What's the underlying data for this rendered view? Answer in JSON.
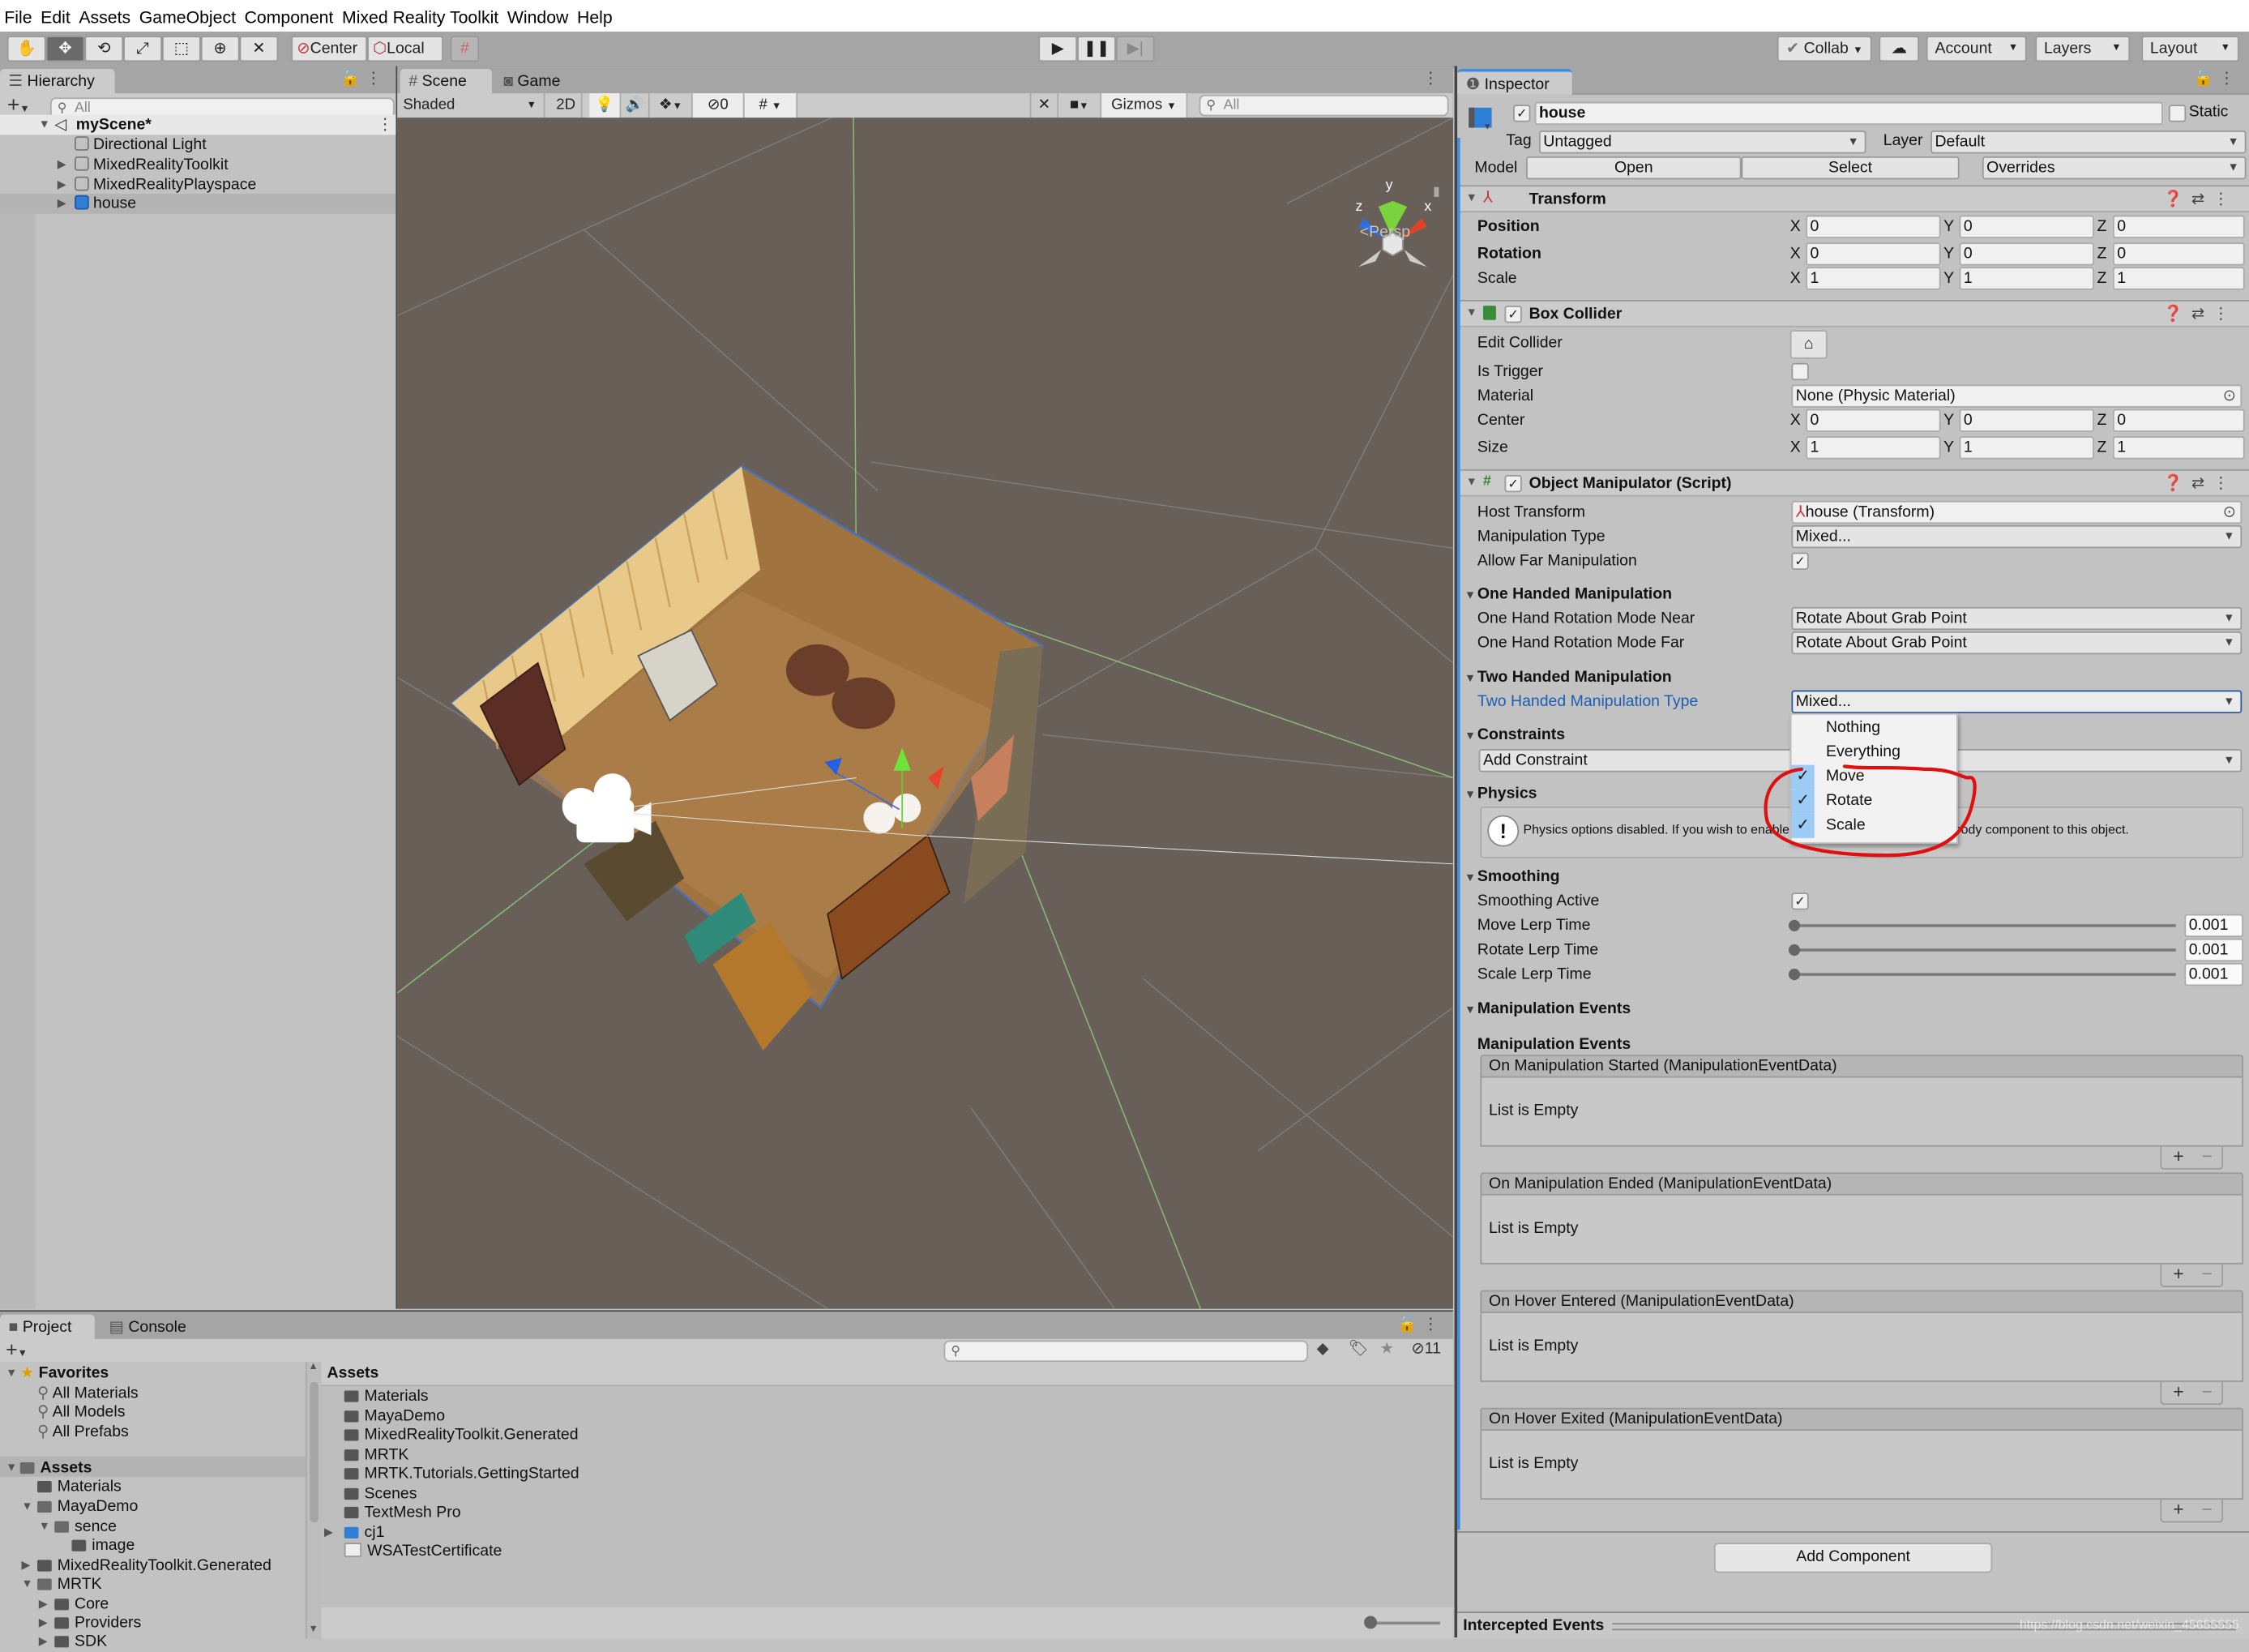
{
  "menu": [
    "File",
    "Edit",
    "Assets",
    "GameObject",
    "Component",
    "Mixed Reality Toolkit",
    "Window",
    "Help"
  ],
  "toolbar": {
    "tools": [
      "hand-tool",
      "move-tool",
      "rotate-tool",
      "scale-tool",
      "rect-tool",
      "transform-tool",
      "custom-tool"
    ],
    "pivot_label": "Center",
    "space_label": "Local",
    "collab_label": "Collab",
    "account_label": "Account",
    "layers_label": "Layers",
    "layout_label": "Layout"
  },
  "hierarchy": {
    "tab_label": "Hierarchy",
    "search_placeholder": "All",
    "scene_name": "myScene*",
    "items": [
      {
        "label": "Directional Light",
        "expandable": false,
        "selected": false
      },
      {
        "label": "MixedRealityToolkit",
        "expandable": true,
        "selected": false
      },
      {
        "label": "MixedRealityPlayspace",
        "expandable": true,
        "selected": false
      },
      {
        "label": "house",
        "expandable": true,
        "selected": true
      }
    ]
  },
  "scene": {
    "tabs": [
      "Scene",
      "Game"
    ],
    "active_tab": "Scene",
    "shading_mode": "Shaded",
    "mode_2d": "2D",
    "hidden_count": "0",
    "gizmos_label": "Gizmos",
    "search_placeholder": "All",
    "projection_label": "Persp",
    "axis_labels": {
      "x": "x",
      "y": "y",
      "z": "z"
    }
  },
  "inspector": {
    "tab_label": "Inspector",
    "object_name": "house",
    "active": true,
    "static_label": "Static",
    "tag_label": "Tag",
    "tag_value": "Untagged",
    "layer_label": "Layer",
    "layer_value": "Default",
    "model_label": "Model",
    "open_label": "Open",
    "select_label": "Select",
    "overrides_label": "Overrides",
    "transform": {
      "title": "Transform",
      "rows": [
        {
          "label": "Position",
          "x": "0",
          "y": "0",
          "z": "0"
        },
        {
          "label": "Rotation",
          "x": "0",
          "y": "0",
          "z": "0"
        },
        {
          "label": "Scale",
          "x": "1",
          "y": "1",
          "z": "1"
        }
      ]
    },
    "box_collider": {
      "title": "Box Collider",
      "enabled": true,
      "edit_collider_label": "Edit Collider",
      "is_trigger_label": "Is Trigger",
      "is_trigger": false,
      "material_label": "Material",
      "material_value": "None (Physic Material)",
      "center": {
        "label": "Center",
        "x": "0",
        "y": "0",
        "z": "0"
      },
      "size": {
        "label": "Size",
        "x": "1",
        "y": "1",
        "z": "1"
      }
    },
    "object_manipulator": {
      "title": "Object Manipulator (Script)",
      "enabled": true,
      "host_transform_label": "Host Transform",
      "host_transform_value": "house (Transform)",
      "manipulation_type_label": "Manipulation Type",
      "manipulation_type_value": "Mixed...",
      "allow_far_label": "Allow Far Manipulation",
      "allow_far": true,
      "one_handed_header": "One Handed Manipulation",
      "one_hand_near_label": "One Hand Rotation Mode Near",
      "one_hand_near_value": "Rotate About Grab Point",
      "one_hand_far_label": "One Hand Rotation Mode Far",
      "one_hand_far_value": "Rotate About Grab Point",
      "two_handed_header": "Two Handed Manipulation",
      "two_handed_type_label": "Two Handed Manipulation Type",
      "two_handed_type_value": "Mixed...",
      "constraints_header": "Constraints",
      "add_constraint_label": "Add Constraint",
      "physics_header": "Physics",
      "physics_message": "Physics options disabled. If you wish to enable physics options, add a Rigidbody component to this object.",
      "smoothing_header": "Smoothing",
      "smoothing_active_label": "Smoothing Active",
      "smoothing_active": true,
      "lerp": [
        {
          "label": "Move Lerp Time",
          "value": "0.001"
        },
        {
          "label": "Rotate Lerp Time",
          "value": "0.001"
        },
        {
          "label": "Scale Lerp Time",
          "value": "0.001"
        }
      ],
      "events_header": "Manipulation Events",
      "events_subheader": "Manipulation Events",
      "events": [
        {
          "title": "On Manipulation Started (ManipulationEventData)",
          "empty_text": "List is Empty"
        },
        {
          "title": "On Manipulation Ended (ManipulationEventData)",
          "empty_text": "List is Empty"
        },
        {
          "title": "On Hover Entered (ManipulationEventData)",
          "empty_text": "List is Empty"
        },
        {
          "title": "On Hover Exited (ManipulationEventData)",
          "empty_text": "List is Empty"
        }
      ]
    },
    "add_component_label": "Add Component",
    "intercepted_events_label": "Intercepted Events",
    "watermark": "https://blog.csdn.net/weixin_45655555"
  },
  "dropdown_menu": {
    "items": [
      {
        "label": "Nothing",
        "checked": false
      },
      {
        "label": "Everything",
        "checked": false
      },
      {
        "label": "Move",
        "checked": true
      },
      {
        "label": "Rotate",
        "checked": true
      },
      {
        "label": "Scale",
        "checked": true
      }
    ],
    "highlight_color": "#e01010"
  },
  "project": {
    "tabs": [
      "Project",
      "Console"
    ],
    "active_tab": "Project",
    "hidden_count": "11",
    "favorites_label": "Favorites",
    "favorites": [
      "All Materials",
      "All Models",
      "All Prefabs"
    ],
    "tree": [
      {
        "label": "Assets",
        "depth": 0,
        "state": "open",
        "selected": true
      },
      {
        "label": "Materials",
        "depth": 1,
        "state": "leaf"
      },
      {
        "label": "MayaDemo",
        "depth": 1,
        "state": "open"
      },
      {
        "label": "sence",
        "depth": 2,
        "state": "open"
      },
      {
        "label": "image",
        "depth": 3,
        "state": "leaf"
      },
      {
        "label": "MixedRealityToolkit.Generated",
        "depth": 1,
        "state": "closed"
      },
      {
        "label": "MRTK",
        "depth": 1,
        "state": "open"
      },
      {
        "label": "Core",
        "depth": 2,
        "state": "closed"
      },
      {
        "label": "Providers",
        "depth": 2,
        "state": "closed"
      },
      {
        "label": "SDK",
        "depth": 2,
        "state": "closed"
      }
    ],
    "breadcrumb": "Assets",
    "assets": [
      {
        "label": "Materials",
        "type": "folder"
      },
      {
        "label": "MayaDemo",
        "type": "folder"
      },
      {
        "label": "MixedRealityToolkit.Generated",
        "type": "folder"
      },
      {
        "label": "MRTK",
        "type": "folder"
      },
      {
        "label": "MRTK.Tutorials.GettingStarted",
        "type": "folder"
      },
      {
        "label": "Scenes",
        "type": "folder"
      },
      {
        "label": "TextMesh Pro",
        "type": "folder"
      },
      {
        "label": "cj1",
        "type": "prefab"
      },
      {
        "label": "WSATestCertificate",
        "type": "certificate"
      }
    ]
  },
  "colors": {
    "accent_blue": "#3a8ee6",
    "selection": "#9ccbf5",
    "annotation_red": "#e01010"
  }
}
